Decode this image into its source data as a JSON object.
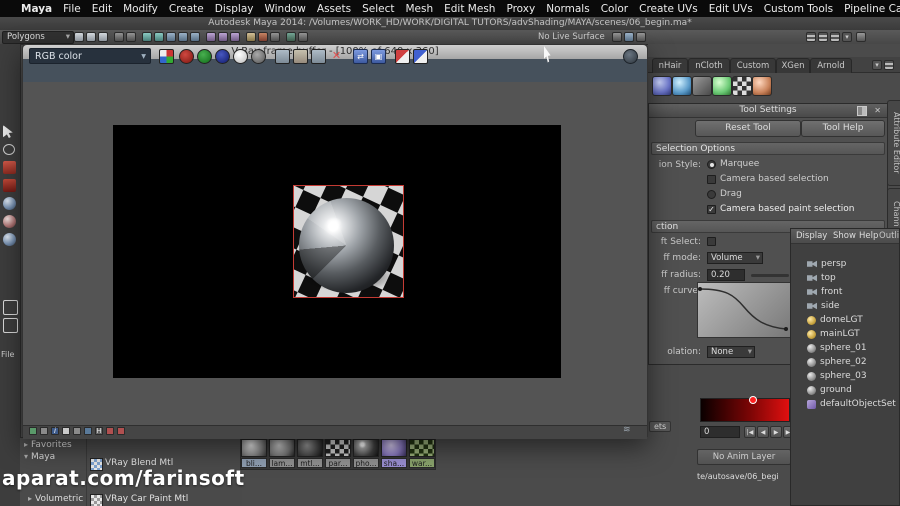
{
  "colors": {
    "region_red": "#c43b34",
    "vfb_toolbar": "#46515c",
    "menubar_bg": "#0a0a0a"
  },
  "menubar": {
    "items": [
      "Maya",
      "File",
      "Edit",
      "Modify",
      "Create",
      "Display",
      "Window",
      "Assets",
      "Select",
      "Mesh",
      "Edit Mesh",
      "Proxy",
      "Normals",
      "Color",
      "Create UVs",
      "Edit UVs",
      "Custom Tools",
      "Pipeline Cache"
    ]
  },
  "titlebar": {
    "title": "Autodesk Maya 2014: /Volumes/WORK_HD/WORK/DIGITAL TUTORS/advShading/MAYA/scenes/06_begin.ma*"
  },
  "statusline": {
    "menuset": "Polygons",
    "live_surface": "No Live Surface"
  },
  "vfb": {
    "title": "V-Ray frame buffer - [100% of 640 x 360]",
    "channel": "RGB color"
  },
  "shelf": {
    "tabs": [
      "nHair",
      "nCloth",
      "Custom",
      "XGen",
      "Arnold"
    ]
  },
  "side_tabs": {
    "attribute_editor": "Attribute Editor",
    "channel_box": "Chann"
  },
  "tool_settings": {
    "title": "Tool Settings",
    "reset_button": "Reset Tool",
    "help_button": "Tool Help",
    "section1": "Selection Options",
    "style_label": "ion Style:",
    "style_marquee": "Marquee",
    "camera_based": "Camera based selection",
    "drag": "Drag",
    "camera_paint": "Camera based paint selection",
    "section2": "ction",
    "soft_select_label": "ft Select:",
    "mode_label": "ff mode:",
    "mode_value": "Volume",
    "radius_label": "ff radius:",
    "radius_value": "0.20",
    "curve_label": "ff curve:",
    "interp_label": "olation:",
    "interp_value": "None"
  },
  "outliner": {
    "title": "Outliner",
    "menus": [
      "Display",
      "Show",
      "Help"
    ],
    "items": [
      {
        "label": "persp",
        "icon": "camera-icon"
      },
      {
        "label": "top",
        "icon": "camera-icon"
      },
      {
        "label": "front",
        "icon": "camera-icon"
      },
      {
        "label": "side",
        "icon": "camera-icon"
      },
      {
        "label": "domeLGT",
        "icon": "light-icon"
      },
      {
        "label": "mainLGT",
        "icon": "light-icon"
      },
      {
        "label": "sphere_01",
        "icon": "mesh-icon"
      },
      {
        "label": "sphere_02",
        "icon": "mesh-icon"
      },
      {
        "label": "sphere_03",
        "icon": "mesh-icon"
      },
      {
        "label": "ground",
        "icon": "mesh-icon"
      },
      {
        "label": "defaultObjectSet",
        "icon": "set-icon"
      }
    ]
  },
  "anim": {
    "sets_tab": "ets",
    "frame_field": "0",
    "anim_layer": "No Anim Layer",
    "autosave_path": "te/autosave/06_begi"
  },
  "hypershade": {
    "file_tab": "File",
    "tree": [
      "Favorites",
      "Maya",
      "Volumetric"
    ],
    "materials": [
      "VRay Blend Mtl",
      "VRay Car Paint Mtl"
    ],
    "swatch_labels": [
      "bli...",
      "lam...",
      "mtl...",
      "par...",
      "pho...",
      "sha...",
      "war..."
    ]
  },
  "watermark": "aparat.com/farinsoft"
}
